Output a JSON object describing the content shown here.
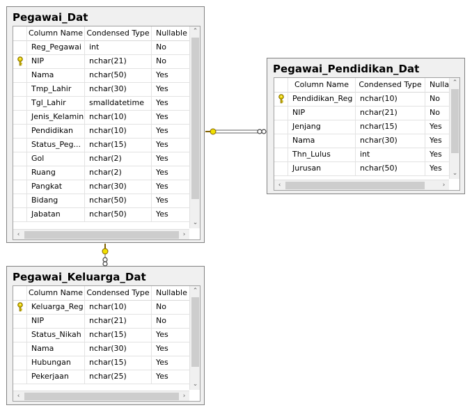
{
  "tables": {
    "pegawai": {
      "title": "Pegawai_Dat",
      "headers": [
        "Column Name",
        "Condensed Type",
        "Nullable"
      ],
      "rows": [
        {
          "name": "Reg_Pegawai",
          "type": "int",
          "nullable": "No",
          "key": false
        },
        {
          "name": "NIP",
          "type": "nchar(21)",
          "nullable": "No",
          "key": true
        },
        {
          "name": "Nama",
          "type": "nchar(50)",
          "nullable": "Yes",
          "key": false
        },
        {
          "name": "Tmp_Lahir",
          "type": "nchar(30)",
          "nullable": "Yes",
          "key": false
        },
        {
          "name": "Tgl_Lahir",
          "type": "smalldatetime",
          "nullable": "Yes",
          "key": false
        },
        {
          "name": "Jenis_Kelamin",
          "type": "nchar(10)",
          "nullable": "Yes",
          "key": false
        },
        {
          "name": "Pendidikan",
          "type": "nchar(10)",
          "nullable": "Yes",
          "key": false
        },
        {
          "name": "Status_Peg...",
          "type": "nchar(15)",
          "nullable": "Yes",
          "key": false
        },
        {
          "name": "Gol",
          "type": "nchar(2)",
          "nullable": "Yes",
          "key": false
        },
        {
          "name": "Ruang",
          "type": "nchar(2)",
          "nullable": "Yes",
          "key": false
        },
        {
          "name": "Pangkat",
          "type": "nchar(30)",
          "nullable": "Yes",
          "key": false
        },
        {
          "name": "Bidang",
          "type": "nchar(50)",
          "nullable": "Yes",
          "key": false
        },
        {
          "name": "Jabatan",
          "type": "nchar(50)",
          "nullable": "Yes",
          "key": false
        }
      ]
    },
    "pendidikan": {
      "title": "Pegawai_Pendidikan_Dat",
      "headers": [
        "Column Name",
        "Condensed Type",
        "Nullab"
      ],
      "rows": [
        {
          "name": "Pendidikan_Reg",
          "type": "nchar(10)",
          "nullable": "No",
          "key": true
        },
        {
          "name": "NIP",
          "type": "nchar(21)",
          "nullable": "No",
          "key": false
        },
        {
          "name": "Jenjang",
          "type": "nchar(15)",
          "nullable": "Yes",
          "key": false
        },
        {
          "name": "Nama",
          "type": "nchar(30)",
          "nullable": "Yes",
          "key": false
        },
        {
          "name": "Thn_Lulus",
          "type": "int",
          "nullable": "Yes",
          "key": false
        },
        {
          "name": "Jurusan",
          "type": "nchar(50)",
          "nullable": "Yes",
          "key": false
        }
      ]
    },
    "keluarga": {
      "title": "Pegawai_Keluarga_Dat",
      "headers": [
        "Column Name",
        "Condensed Type",
        "Nullable"
      ],
      "rows": [
        {
          "name": "Keluarga_Reg",
          "type": "nchar(10)",
          "nullable": "No",
          "key": true
        },
        {
          "name": "NIP",
          "type": "nchar(21)",
          "nullable": "No",
          "key": false
        },
        {
          "name": "Status_Nikah",
          "type": "nchar(15)",
          "nullable": "Yes",
          "key": false
        },
        {
          "name": "Nama",
          "type": "nchar(30)",
          "nullable": "Yes",
          "key": false
        },
        {
          "name": "Hubungan",
          "type": "nchar(15)",
          "nullable": "Yes",
          "key": false
        },
        {
          "name": "Pekerjaan",
          "type": "nchar(25)",
          "nullable": "Yes",
          "key": false
        }
      ]
    }
  },
  "colors": {
    "key_icon": "#e8d000",
    "connector": "#606060",
    "connector_end": "#f0e000"
  },
  "icons": {
    "primary_key": "key-icon",
    "relationship_one": "key-endpoint-icon",
    "relationship_many": "infinity-endpoint-icon"
  }
}
